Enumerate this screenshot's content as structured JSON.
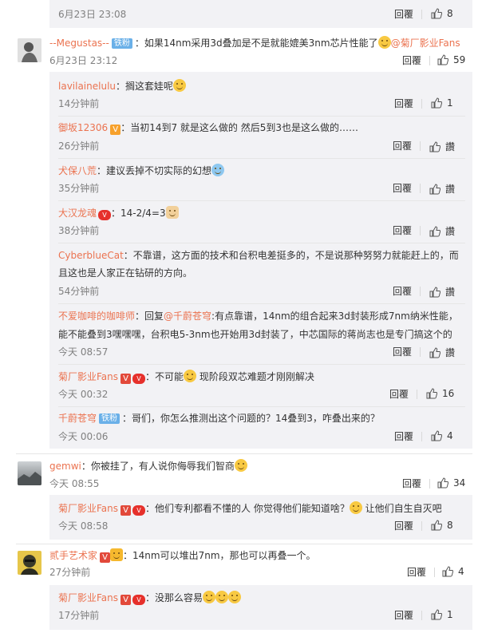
{
  "top": {
    "time": "6月23日 23:08",
    "reply": "回覆",
    "likes": "8"
  },
  "comments": [
    {
      "name": "--Megustas--",
      "badge": "铁粉",
      "text": "：如果14nm采用3d叠加是不是就能媲美3nm芯片性能了",
      "mention": "@菊厂影业Fans",
      "time": "6月23日 23:12",
      "reply": "回覆",
      "likes": "59",
      "replies": [
        {
          "name": "lavilainelulu",
          "text": "：搁这套娃呢",
          "time": "14分钟前",
          "reply": "回覆",
          "likes": "1"
        },
        {
          "name": "御坂12306",
          "text": "：当初14到7 就是这么做的 然后5到3也是这么做的……",
          "time": "26分钟前",
          "reply": "回覆",
          "likes": "讚"
        },
        {
          "name": "犬保八荒",
          "text": "：建议丢掉不切实际的幻想",
          "time": "35分钟前",
          "reply": "回覆",
          "likes": "讚"
        },
        {
          "name": "大汉龙魂",
          "text": "：14-2/4=3",
          "time": "38分钟前",
          "reply": "回覆",
          "likes": "讚"
        },
        {
          "name": "CyberblueCat",
          "text": "：不靠谱，这方面的技术和台积电差挺多的，不是说那种努努力就能赶上的，而",
          "text2": "且这也是人家正在钻研的方向。",
          "time": "54分钟前",
          "reply": "回覆",
          "likes": "讚"
        },
        {
          "name": "不爱咖啡的咖啡师",
          "text": "：回复",
          "mention": "@千蔚苍穹",
          "text_b": ":有点靠谱，14nm的组合起来3d封装形成7nm纳米性能，",
          "text2": "能不能叠到3嘿嘿嘿，台积电5-3nm也开始用3d封装了，中芯国际的蒋尚志也是专门搞这个的",
          "time": "今天 08:57",
          "reply": "回覆",
          "likes": "讚"
        },
        {
          "name": "菊厂影业Fans",
          "text": "：不可能",
          "text_b": " 现阶段双芯难题才刚刚解决",
          "time": "今天 00:32",
          "reply": "回覆",
          "likes": "16"
        },
        {
          "name": "千蔚苍穹",
          "badge": "铁粉",
          "text": "：哥们，你怎么推测出这个问题的？14叠到3，咋叠出来的？",
          "time": "今天 00:06",
          "reply": "回覆",
          "likes": "4"
        }
      ]
    },
    {
      "name": "gemwi",
      "text": "：你被挂了，有人说你侮辱我们智商",
      "time": "今天 08:55",
      "reply": "回覆",
      "likes": "34",
      "replies": [
        {
          "name": "菊厂影业Fans",
          "text": "：他们专利都看不懂的人  你觉得他们能知道啥？",
          "text_b": " 让他们自生自灭吧",
          "time": "今天 08:58",
          "reply": "回覆",
          "likes": "8"
        }
      ]
    },
    {
      "name": "贰手艺术家",
      "text": "：14nm可以堆出7nm，那也可以再叠一个。",
      "time": "27分钟前",
      "reply": "回覆",
      "likes": "4",
      "replies": [
        {
          "name": "菊厂影业Fans",
          "text": "：没那么容易",
          "time": "17分钟前",
          "reply": "回覆",
          "likes": "1"
        }
      ]
    }
  ],
  "icons": {
    "like": "thumbs-up-icon"
  },
  "colors": {
    "name": "#eb7350",
    "reply_bg": "#f2f2f5",
    "meta": "#808080"
  }
}
